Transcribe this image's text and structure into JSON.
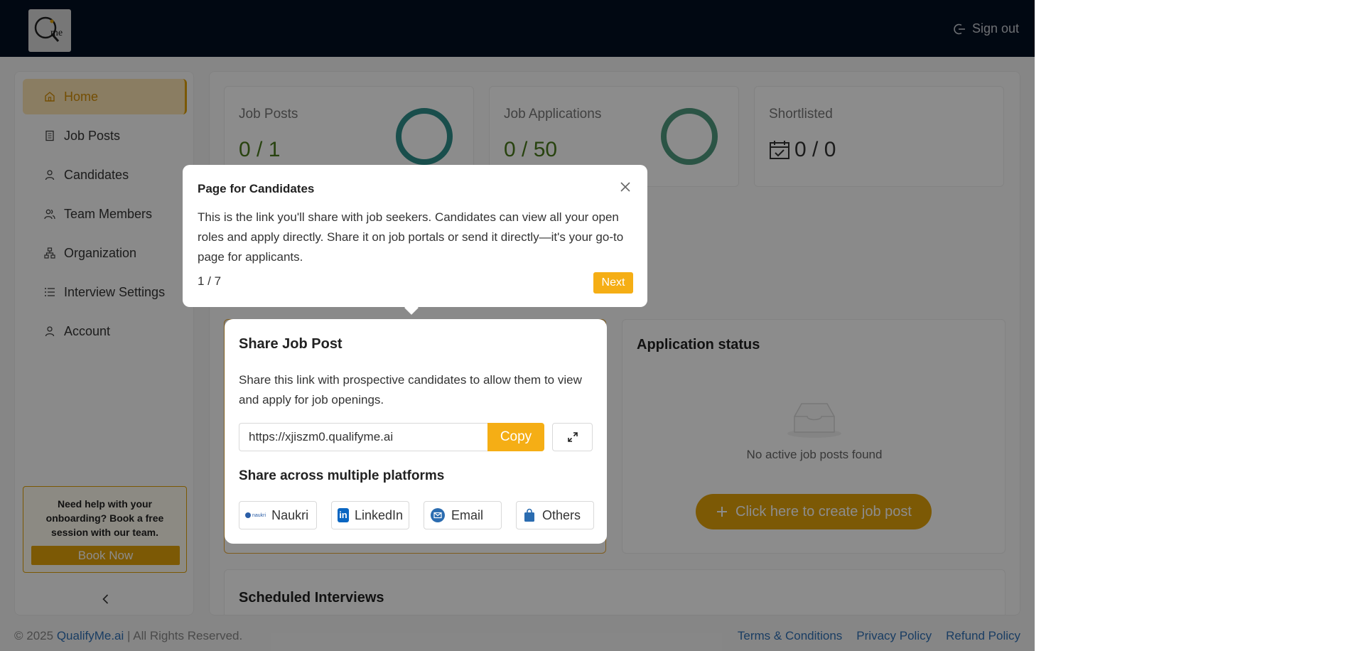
{
  "header": {
    "logo_text": "me",
    "sign_out_label": "Sign out"
  },
  "sidebar": {
    "items": [
      {
        "label": "Home",
        "icon": "home-icon",
        "active": true
      },
      {
        "label": "Job Posts",
        "icon": "document-icon"
      },
      {
        "label": "Candidates",
        "icon": "user-icon"
      },
      {
        "label": "Team Members",
        "icon": "team-icon"
      },
      {
        "label": "Organization",
        "icon": "org-chart-icon"
      },
      {
        "label": "Interview Settings",
        "icon": "list-icon"
      },
      {
        "label": "Account",
        "icon": "user-icon"
      }
    ],
    "help_text": "Need help with your onboarding? Book a free session with our team.",
    "book_label": "Book Now"
  },
  "stats": [
    {
      "title": "Job Posts",
      "value": "0 / 1"
    },
    {
      "title": "Job Applications",
      "value": "0 / 50"
    },
    {
      "title": "Shortlisted",
      "value": "0 / 0"
    }
  ],
  "share": {
    "title": "Share Job Post",
    "description": "Share this link with prospective candidates to allow them to view and apply for job openings.",
    "url": "https://xjiszm0.qualifyme.ai",
    "copy_label": "Copy",
    "subtitle": "Share across multiple platforms",
    "platforms": [
      {
        "label": "Naukri",
        "logo_text": "naukri"
      },
      {
        "label": "LinkedIn",
        "logo_text": "in"
      },
      {
        "label": "Email"
      },
      {
        "label": "Others"
      }
    ]
  },
  "status": {
    "title": "Application status",
    "empty_text": "No active job posts found",
    "create_label": "Click here to create job post"
  },
  "scheduled": {
    "title": "Scheduled Interviews"
  },
  "tour": {
    "title": "Page for Candidates",
    "description": "This is the link you'll share with job seekers. Candidates can view all your open roles and apply directly. Share it on job portals or send it directly—it's your go-to page for applicants.",
    "step": "1 / 7",
    "next_label": "Next"
  },
  "footer": {
    "copyright_prefix": "© 2025",
    "brand": "QualifyMe.ai",
    "rights": "| All Rights Reserved.",
    "links": [
      "Terms & Conditions",
      "Privacy Policy",
      "Refund Policy"
    ]
  },
  "colors": {
    "topbar": "#020f21",
    "accent": "#f5ae15",
    "stat_value": "#4a7a1c",
    "link": "#2f6fb5"
  }
}
